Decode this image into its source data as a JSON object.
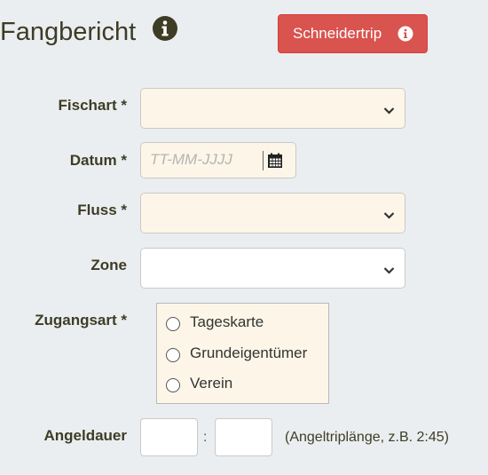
{
  "header": {
    "title": "Fangbericht",
    "info_icon": "info-circle-icon",
    "schneidertrip_button": "Schneidertrip",
    "button_color": "#d9534f"
  },
  "form": {
    "fischart": {
      "label": "Fischart *",
      "value": ""
    },
    "datum": {
      "label": "Datum *",
      "placeholder": "TT-MM-JJJJ",
      "icon": "calendar-icon"
    },
    "fluss": {
      "label": "Fluss *",
      "value": ""
    },
    "zone": {
      "label": "Zone",
      "value": ""
    },
    "zugangsart": {
      "label": "Zugangsart *",
      "options": [
        "Tageskarte",
        "Grundeigentümer",
        "Verein"
      ]
    },
    "angeldauer": {
      "label": "Angeldauer",
      "separator": ":",
      "hint": "(Angeltriplänge, z.B. 2:45)"
    }
  },
  "colors": {
    "required_bg": "#fdf6e8",
    "page_bg": "#ebeef0",
    "label_color": "#3d3d26"
  }
}
